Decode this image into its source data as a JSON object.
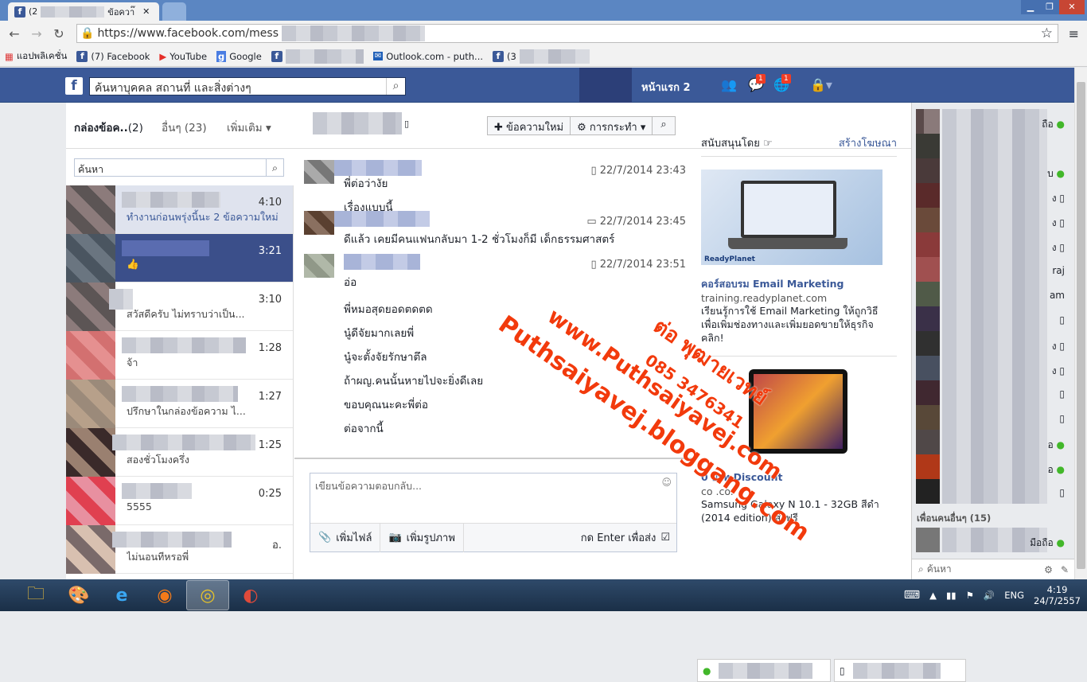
{
  "browser": {
    "tabs": [
      {
        "label": "(2",
        "label2": "ข้อควา๊"
      }
    ],
    "url": "https://www.facebook.com/mess",
    "bookmarks": [
      "แอปพลิเคชั่น",
      "(7) Facebook",
      "YouTube",
      "Google",
      "Outlook.com - puth...",
      "(3"
    ]
  },
  "fb_header": {
    "logo": "f",
    "search_placeholder": "ค้นหาบุคคล สถานที่ และสิ่งต่างๆ",
    "home_label": "หน้าแรก",
    "home_count": "2",
    "messages_badge": "1",
    "notifications_badge": "1"
  },
  "messages": {
    "tabs": {
      "inbox": "กล่องข้อค..",
      "inbox_count": "(2)",
      "other": "อื่นๆ (23)",
      "more": "เพิ่มเติม"
    },
    "new_message": "ข้อความใหม่",
    "actions": "การกระทำ",
    "search_placeholder": "ค้นหา",
    "threads": [
      {
        "time": "4:10",
        "snippet": "ทำงานก่อนพรุ่งนี้นะ 2 ข้อความใหม่"
      },
      {
        "time": "3:21",
        "snippet": "👍"
      },
      {
        "time": "3:10",
        "snippet": "สวัสดีครับ ไม่ทราบว่าเป็น..."
      },
      {
        "time": "1:28",
        "snippet": "จ้า"
      },
      {
        "time": "1:27",
        "snippet": "ปรึกษาในกล่องข้อความ ไ..."
      },
      {
        "time": "1:25",
        "snippet": "สองชั่วโมงครึ่ง"
      },
      {
        "time": "0:25",
        "snippet": "5555"
      },
      {
        "time": "อ.",
        "snippet": "ไม่นอนทีหรอพี่"
      }
    ],
    "conversation": [
      {
        "ts": "22/7/2014 23:43",
        "text": "พี่ต่อว่างัย"
      },
      {
        "text": "เรื่องแบบนี้"
      },
      {
        "ts": "22/7/2014 23:45",
        "text": "ดีแล้ว เคยมีคนแฟนกลับมา 1-2 ชั่วโมงก็มี เด็กธรรมศาสตร์"
      },
      {
        "ts": "22/7/2014 23:51",
        "text": "อ่อ"
      },
      {
        "text": "พี่หมอสุดยอดตดตด"
      },
      {
        "text": "นู๋ดีจัยมากเลยพี่"
      },
      {
        "text": "นู๋จะตั้งจัยรักษาตึล"
      },
      {
        "text": "ถ้าผญ.คนนั้นหายไปจะยิ่งดีเลย"
      },
      {
        "text": "ขอบคุณนะคะพี่ต่อ"
      },
      {
        "text": "ต่อจากนี้"
      }
    ],
    "reply_placeholder": "เขียนข้อความตอบกลับ...",
    "attach_file": "เพิ่มไฟล์",
    "add_photo": "เพิ่มรูปภาพ",
    "enter_to_send": "กด Enter เพื่อส่ง"
  },
  "ads": {
    "sponsored": "สนับสนุนโดย",
    "create_ad": "สร้างโฆษณา",
    "ad1_title": "คอร์สอบรม Email Marketing",
    "ad1_url": "training.readyplanet.com",
    "ad1_desc": "เรียนรู้การใช้ Email Marketing ให้ถูกวิธี เพื่อเพิ่มช่องทางและเพิ่มยอดขายให้ธุรกิจ คลิก!",
    "ad1_brand": "ReadyPlanet",
    "ad2_title": "0 บาท Discount",
    "ad2_url": "co  .co.",
    "ad2_desc": "Samsung Galaxy N 10.1 - 32GB สีดำ (2014 edition) ส่งฟรี"
  },
  "chat": {
    "more_friends": "เพื่อนคนอื่นๆ (15)",
    "mobile_label": "มือถือ",
    "search_placeholder": "ค้นหา",
    "partial_raj": "raj",
    "partial_am": "am"
  },
  "watermark": {
    "line1": "ต่อ พุฒายเวทย์",
    "line2": "085 3476341",
    "line3": "www.Puthsaiyavej.com",
    "line4": "Puthsaiyavej.bloggang.com"
  },
  "taskbar": {
    "lang": "ENG",
    "time": "4:19",
    "date": "24/7/2557"
  }
}
